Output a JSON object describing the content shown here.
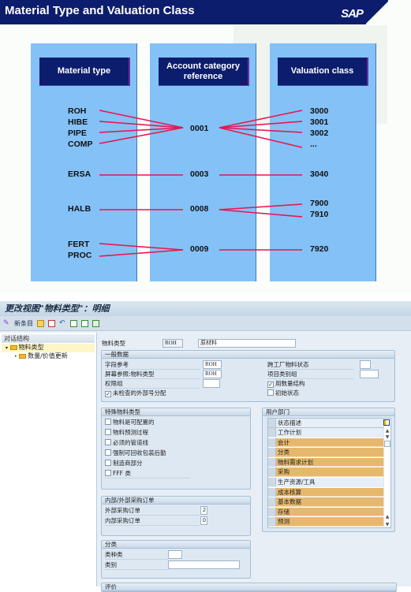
{
  "slide": {
    "title": "Material Type and Valuation Class",
    "logo": "SAP",
    "columns": [
      {
        "header": "Material type"
      },
      {
        "header": "Account category reference"
      },
      {
        "header": "Valuation class"
      }
    ],
    "material_types": [
      "ROH",
      "HIBE",
      "PIPE",
      "COMP",
      "ERSA",
      "HALB",
      "FERT",
      "PROC"
    ],
    "account_refs": [
      "0001",
      "0003",
      "0008",
      "0009"
    ],
    "valuation_classes": [
      "3000",
      "3001",
      "3002",
      "...",
      "3040",
      "7900",
      "7910",
      "7920"
    ],
    "colors": {
      "title_bg": "#0d1d6d",
      "column_bg": "#84c1f7",
      "line": "#e8174f"
    }
  },
  "sap": {
    "window_title": "更改视图\"物料类型\"：明细",
    "toolbar": {
      "new_entries": "新条目"
    },
    "nav": {
      "header": "对话结构",
      "items": [
        {
          "label": "物料类型",
          "selected": true
        },
        {
          "label": "数量/价值更新",
          "selected": false
        }
      ]
    },
    "material_type": {
      "label": "物料类型",
      "code": "ROH",
      "description": "原材料"
    },
    "general": {
      "title": "一般数据",
      "field_ref_label": "字段参考",
      "field_ref_value": "ROH",
      "screen_ref_label": "屏幕参照:物料类型",
      "screen_ref_value": "ROH",
      "auth_group_label": "权限组",
      "auth_group_value": "",
      "ext_num_label": "未检查的外部号分配",
      "ext_num_checked": true,
      "cross_plant_label": "跨工厂物料状态",
      "item_cat_label": "项目类别组",
      "qty_struct_label": "用数量结构",
      "qty_struct_checked": true,
      "initial_status_label": "初始状态",
      "initial_status_checked": false
    },
    "special": {
      "title": "特殊物料类型",
      "items": [
        {
          "label": "物料是可配置的",
          "checked": false
        },
        {
          "label": "物料预测过程",
          "checked": false
        },
        {
          "label": "必须的管道线",
          "checked": false
        },
        {
          "label": "强制可回收包装后勤",
          "checked": false
        },
        {
          "label": "制造商部分",
          "checked": false
        },
        {
          "label": "FFF 类",
          "checked": false
        }
      ]
    },
    "user_dept": {
      "title": "用户部门",
      "column_header": "状态描述",
      "rows": [
        {
          "label": "工作计划",
          "selected": false
        },
        {
          "label": "会计",
          "selected": true
        },
        {
          "label": "分类",
          "selected": true
        },
        {
          "label": "物料需求计划",
          "selected": true
        },
        {
          "label": "采购",
          "selected": true
        },
        {
          "label": "生产资源/工具",
          "selected": false
        },
        {
          "label": "成本核算",
          "selected": true
        },
        {
          "label": "基本数据",
          "selected": true
        },
        {
          "label": "存储",
          "selected": true
        },
        {
          "label": "预测",
          "selected": true
        }
      ]
    },
    "po": {
      "title": "内部/外部采购订单",
      "external_label": "外部采购订单",
      "external_value": "2",
      "internal_label": "内部采购订单",
      "internal_value": "0"
    },
    "classification": {
      "title": "分类",
      "class_type_label": "类种类",
      "class_type_value": "",
      "class_label": "类别",
      "class_value": ""
    },
    "valuation": {
      "title": "评价"
    }
  }
}
